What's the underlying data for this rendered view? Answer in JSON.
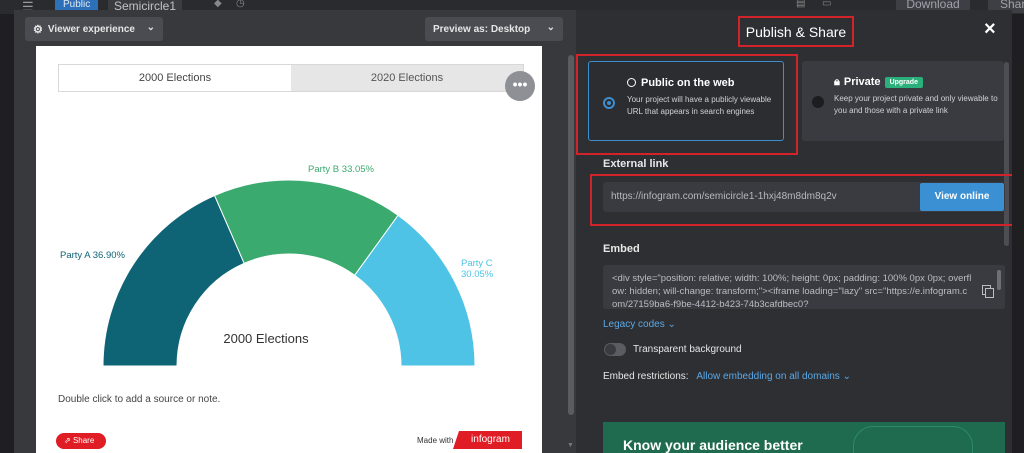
{
  "topbar": {
    "public_badge": "Public",
    "project_name": "Semicircle1",
    "download_label": "Download",
    "share_label": "Shar"
  },
  "left_panel": {
    "viewer_experience_label": "Viewer experience",
    "preview_label": "Preview as:  Desktop",
    "more_label": "•••",
    "tabs": [
      {
        "label": "2000 Elections",
        "active": true
      },
      {
        "label": "2020 Elections",
        "active": false
      }
    ],
    "note": "Double click to add a source or note.",
    "share_pill": "Share",
    "made_with": "Made with",
    "brand": "infogram"
  },
  "chart_data": {
    "type": "pie",
    "subtype": "semicircle",
    "center_label": "2000 Elections",
    "slices": [
      {
        "label": "Party A 36.90%",
        "name": "Party A",
        "value": 36.9,
        "color": "#0e6474"
      },
      {
        "label": "Party B 33.05%",
        "name": "Party B",
        "value": 33.05,
        "color": "#3aaa6e"
      },
      {
        "label_line1": "Party C",
        "label_line2": "30.05%",
        "name": "Party C",
        "value": 30.05,
        "color": "#4fc3e5"
      }
    ]
  },
  "right_panel": {
    "title": "Publish & Share",
    "close_icon": "×",
    "public_option": {
      "title": "Public on the web",
      "description": "Your project will have a publicly viewable URL that appears in search engines"
    },
    "private_option": {
      "title": "Private",
      "badge": "Upgrade",
      "description": "Keep your project private and only viewable to you and those with a private link"
    },
    "external_link_label": "External link",
    "external_link_url": "https://infogram.com/semicircle1-1hxj48m8dm8q2v",
    "view_online_label": "View online",
    "embed_label": "Embed",
    "embed_code": "<div style=\"position: relative; width: 100%; height: 0px; padding: 100% 0px 0px; overflow: hidden; will-change: transform;\"><iframe loading=\"lazy\" src=\"https://e.infogram.com/27159ba6-f9be-4412-b423-74b3cafdbec0?",
    "legacy_codes_label": "Legacy codes",
    "transparent_bg_label": "Transparent background",
    "embed_restrictions_label": "Embed restrictions:",
    "embed_restrictions_value": "Allow embedding on all domains",
    "promo_title": "Know your audience better"
  },
  "colors": {
    "accent_blue": "#3b8fd3",
    "highlight_red": "#d2232b",
    "upgrade_green": "#2bb07b",
    "brand_red": "#e01c24"
  }
}
